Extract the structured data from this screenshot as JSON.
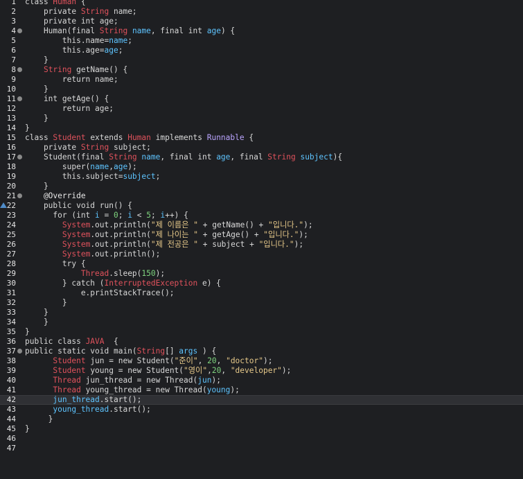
{
  "editor": {
    "lines": [
      {
        "n": "1",
        "tokens": [
          [
            "k",
            "class "
          ],
          [
            "t",
            "Human"
          ],
          [
            "k",
            " {"
          ]
        ]
      },
      {
        "n": "2",
        "tokens": [
          [
            "k",
            "    private "
          ],
          [
            "t",
            "String"
          ],
          [
            "k",
            " name;"
          ]
        ]
      },
      {
        "n": "3",
        "tokens": [
          [
            "k",
            "    private int age;"
          ]
        ]
      },
      {
        "n": "4",
        "fold": true,
        "tokens": [
          [
            "k",
            "    Human(final "
          ],
          [
            "t",
            "String"
          ],
          [
            "p",
            " name"
          ],
          [
            "k",
            ", final int "
          ],
          [
            "p",
            "age"
          ],
          [
            "k",
            ") {"
          ]
        ]
      },
      {
        "n": "5",
        "tokens": [
          [
            "k",
            "        this.name="
          ],
          [
            "p",
            "name"
          ],
          [
            "k",
            ";"
          ]
        ]
      },
      {
        "n": "6",
        "tokens": [
          [
            "k",
            "        this.age="
          ],
          [
            "p",
            "age"
          ],
          [
            "k",
            ";"
          ]
        ]
      },
      {
        "n": "7",
        "tokens": [
          [
            "k",
            "    }"
          ]
        ]
      },
      {
        "n": "8",
        "fold": true,
        "tokens": [
          [
            "k",
            "    "
          ],
          [
            "t",
            "String"
          ],
          [
            "k",
            " getName() {"
          ]
        ]
      },
      {
        "n": "9",
        "tokens": [
          [
            "k",
            "        return name;"
          ]
        ]
      },
      {
        "n": "10",
        "tokens": [
          [
            "k",
            "    }"
          ]
        ]
      },
      {
        "n": "11",
        "fold": true,
        "tokens": [
          [
            "k",
            "    int getAge() {"
          ]
        ]
      },
      {
        "n": "12",
        "tokens": [
          [
            "k",
            "        return age;"
          ]
        ]
      },
      {
        "n": "13",
        "tokens": [
          [
            "k",
            "    }"
          ]
        ]
      },
      {
        "n": "14",
        "tokens": [
          [
            "k",
            "}"
          ]
        ]
      },
      {
        "n": "15",
        "tokens": [
          [
            "k",
            "class "
          ],
          [
            "t",
            "Student"
          ],
          [
            "k",
            " extends "
          ],
          [
            "t",
            "Human"
          ],
          [
            "k",
            " implements "
          ],
          [
            "c",
            "Runnable"
          ],
          [
            "k",
            " {"
          ]
        ]
      },
      {
        "n": "16",
        "tokens": [
          [
            "k",
            "    private "
          ],
          [
            "t",
            "String"
          ],
          [
            "k",
            " subject;"
          ]
        ]
      },
      {
        "n": "17",
        "fold": true,
        "tokens": [
          [
            "k",
            "    Student(final "
          ],
          [
            "t",
            "String"
          ],
          [
            "p",
            " name"
          ],
          [
            "k",
            ", final int "
          ],
          [
            "p",
            "age"
          ],
          [
            "k",
            ", final "
          ],
          [
            "t",
            "String"
          ],
          [
            "p",
            " subject"
          ],
          [
            "k",
            "){"
          ]
        ]
      },
      {
        "n": "18",
        "tokens": [
          [
            "k",
            "        super("
          ],
          [
            "p",
            "name"
          ],
          [
            "k",
            ","
          ],
          [
            "p",
            "age"
          ],
          [
            "k",
            ");"
          ]
        ]
      },
      {
        "n": "19",
        "tokens": [
          [
            "k",
            "        this.subject="
          ],
          [
            "p",
            "subject"
          ],
          [
            "k",
            ";"
          ]
        ]
      },
      {
        "n": "20",
        "tokens": [
          [
            "k",
            "    }"
          ]
        ]
      },
      {
        "n": "21",
        "fold": true,
        "tokens": [
          [
            "a",
            "    @Override"
          ]
        ]
      },
      {
        "n": "22",
        "marker": true,
        "tokens": [
          [
            "k",
            "    public void run() {"
          ]
        ]
      },
      {
        "n": "23",
        "tokens": [
          [
            "k",
            "      for (int "
          ],
          [
            "p",
            "i"
          ],
          [
            "k",
            " = "
          ],
          [
            "n",
            "0"
          ],
          [
            "k",
            "; "
          ],
          [
            "p",
            "i"
          ],
          [
            "k",
            " < "
          ],
          [
            "n",
            "5"
          ],
          [
            "k",
            "; "
          ],
          [
            "p",
            "i"
          ],
          [
            "k",
            "++) {"
          ]
        ]
      },
      {
        "n": "24",
        "tokens": [
          [
            "k",
            "        "
          ],
          [
            "t",
            "System"
          ],
          [
            "k",
            ".out.println("
          ],
          [
            "s",
            "\"제 이름은 \""
          ],
          [
            "k",
            " + getName() + "
          ],
          [
            "s",
            "\"입니다.\""
          ],
          [
            "k",
            ");"
          ]
        ]
      },
      {
        "n": "25",
        "tokens": [
          [
            "k",
            "        "
          ],
          [
            "t",
            "System"
          ],
          [
            "k",
            ".out.println("
          ],
          [
            "s",
            "\"제 나이는 \""
          ],
          [
            "k",
            " + getAge() + "
          ],
          [
            "s",
            "\"입니다.\""
          ],
          [
            "k",
            ");"
          ]
        ]
      },
      {
        "n": "26",
        "tokens": [
          [
            "k",
            "        "
          ],
          [
            "t",
            "System"
          ],
          [
            "k",
            ".out.println("
          ],
          [
            "s",
            "\"제 전공은 \""
          ],
          [
            "k",
            " + subject + "
          ],
          [
            "s",
            "\"입니다.\""
          ],
          [
            "k",
            ");"
          ]
        ]
      },
      {
        "n": "27",
        "tokens": [
          [
            "k",
            "        "
          ],
          [
            "t",
            "System"
          ],
          [
            "k",
            ".out.println();"
          ]
        ]
      },
      {
        "n": "28",
        "tokens": [
          [
            "k",
            "        try {"
          ]
        ]
      },
      {
        "n": "29",
        "tokens": [
          [
            "k",
            "            "
          ],
          [
            "t",
            "Thread"
          ],
          [
            "k",
            ".sleep("
          ],
          [
            "n",
            "150"
          ],
          [
            "k",
            ");"
          ]
        ]
      },
      {
        "n": "30",
        "tokens": [
          [
            "k",
            "        } catch ("
          ],
          [
            "t",
            "InterruptedException"
          ],
          [
            "k",
            " e) {"
          ]
        ]
      },
      {
        "n": "31",
        "tokens": [
          [
            "k",
            "            e.printStackTrace();"
          ]
        ]
      },
      {
        "n": "32",
        "tokens": [
          [
            "k",
            "        }"
          ]
        ]
      },
      {
        "n": "33",
        "tokens": [
          [
            "k",
            "    }"
          ]
        ]
      },
      {
        "n": "34",
        "tokens": [
          [
            "k",
            "    }"
          ]
        ]
      },
      {
        "n": "35",
        "tokens": [
          [
            "k",
            "}"
          ]
        ]
      },
      {
        "n": "36",
        "tokens": [
          [
            "k",
            "public class "
          ],
          [
            "t",
            "JAVA"
          ],
          [
            "k",
            "  {"
          ]
        ]
      },
      {
        "n": "37",
        "fold": true,
        "tokens": [
          [
            "k",
            "public static void main("
          ],
          [
            "t",
            "String"
          ],
          [
            "k",
            "[] "
          ],
          [
            "p",
            "args"
          ],
          [
            "k",
            " ) {"
          ]
        ]
      },
      {
        "n": "38",
        "tokens": [
          [
            "k",
            "      "
          ],
          [
            "t",
            "Student"
          ],
          [
            "k",
            " jun = new Student("
          ],
          [
            "s",
            "\"준이\""
          ],
          [
            "k",
            ", "
          ],
          [
            "n",
            "20"
          ],
          [
            "k",
            ", "
          ],
          [
            "s",
            "\"doctor\""
          ],
          [
            "k",
            ");"
          ]
        ]
      },
      {
        "n": "39",
        "tokens": [
          [
            "k",
            "      "
          ],
          [
            "t",
            "Student"
          ],
          [
            "k",
            " young = new Student("
          ],
          [
            "s",
            "\"영이\""
          ],
          [
            "k",
            ","
          ],
          [
            "n",
            "20"
          ],
          [
            "k",
            ", "
          ],
          [
            "s",
            "\"developer\""
          ],
          [
            "k",
            ");"
          ]
        ]
      },
      {
        "n": "40",
        "tokens": [
          [
            "k",
            "      "
          ],
          [
            "t",
            "Thread"
          ],
          [
            "k",
            " jun_thread = new Thread("
          ],
          [
            "p",
            "jun"
          ],
          [
            "k",
            ");"
          ]
        ]
      },
      {
        "n": "41",
        "tokens": [
          [
            "k",
            "      "
          ],
          [
            "t",
            "Thread"
          ],
          [
            "k",
            " young_thread = new Thread("
          ],
          [
            "p",
            "young"
          ],
          [
            "k",
            ");"
          ]
        ]
      },
      {
        "n": "42",
        "current": true,
        "tokens": [
          [
            "p",
            "      jun_thread"
          ],
          [
            "k",
            ".start();"
          ]
        ]
      },
      {
        "n": "43",
        "tokens": [
          [
            "p",
            "      young_thread"
          ],
          [
            "k",
            ".start();"
          ]
        ]
      },
      {
        "n": "44",
        "tokens": [
          [
            "k",
            "     }"
          ]
        ]
      },
      {
        "n": "45",
        "tokens": [
          [
            "k",
            "}"
          ]
        ]
      },
      {
        "n": "46",
        "tokens": []
      },
      {
        "n": "47",
        "tokens": []
      }
    ]
  }
}
